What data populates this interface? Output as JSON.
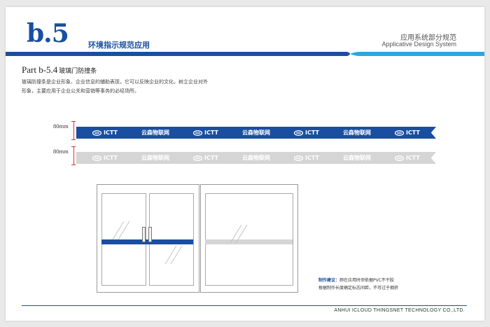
{
  "header": {
    "code": "b.5",
    "section_title": "环境指示规范应用",
    "right_title_cn": "应用系统部分规范",
    "right_title_en": "Applicative Design System"
  },
  "part": {
    "title": "Part b-5.4",
    "subtitle": "玻璃门防撞条"
  },
  "description": [
    "玻璃防撞条是企业形象、企业信息的辅助表现，它可以反映企业的文化，树立企业对外",
    "形象，主要应用于企业公关和营销等事务的必经场所。"
  ],
  "strips": {
    "blue": {
      "height_label": "80mm",
      "color": "#1a4ea0"
    },
    "grey": {
      "height_label": "80mm",
      "color": "#d5d5d5"
    }
  },
  "logos": {
    "icon": "ictt-logo-icon",
    "en": "ICTT",
    "cn": "云森物联网"
  },
  "note": {
    "label": "制作建议：",
    "line1": "颜在应用时须依据PVC不干胶",
    "line2": "根据制作长度确定标志间距，不可过于拥挤"
  },
  "footer": "ANHUI ICLOUD THINGSNET TECHNOLOGY CO.,LTD.",
  "colors": {
    "brand_blue": "#1a4ea0",
    "light_blue": "#2aa7e0",
    "strip_grey": "#d5d5d5"
  }
}
